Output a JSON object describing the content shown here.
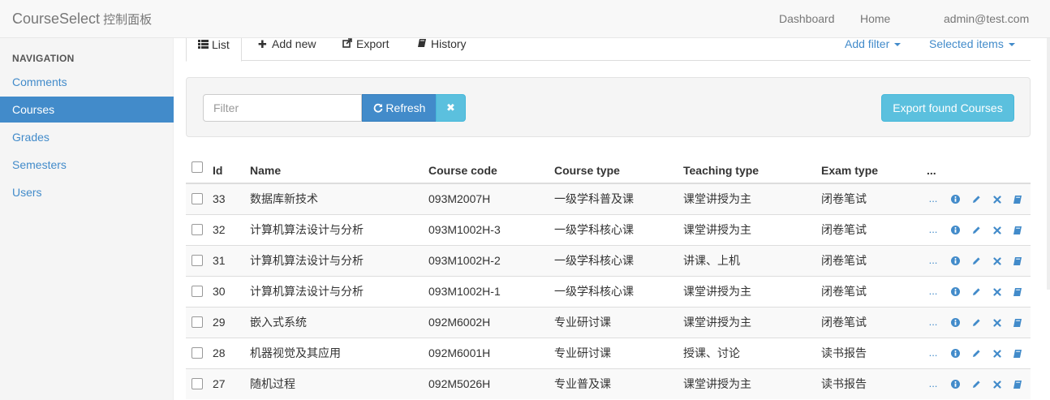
{
  "navbar": {
    "brand": "CourseSelect",
    "brand_sub": "控制面板",
    "links": [
      "Dashboard",
      "Home",
      "admin@test.com"
    ]
  },
  "sidebar": {
    "header": "NAVIGATION",
    "items": [
      {
        "label": "Comments",
        "active": false
      },
      {
        "label": "Courses",
        "active": true
      },
      {
        "label": "Grades",
        "active": false
      },
      {
        "label": "Semesters",
        "active": false
      },
      {
        "label": "Users",
        "active": false
      }
    ]
  },
  "tabs": {
    "list": "List",
    "add_new": "Add new",
    "export": "Export",
    "history": "History",
    "add_filter": "Add filter",
    "selected_items": "Selected items"
  },
  "filter": {
    "placeholder": "Filter",
    "refresh_label": "Refresh",
    "clear_label": "✖",
    "export_found_label": "Export found Courses"
  },
  "table": {
    "headers": [
      "Id",
      "Name",
      "Course code",
      "Course type",
      "Teaching type",
      "Exam type",
      "..."
    ],
    "rows": [
      {
        "id": "33",
        "name": "数据库新技术",
        "code": "093M2007H",
        "course_type": "一级学科普及课",
        "teaching_type": "课堂讲授为主",
        "exam_type": "闭卷笔试"
      },
      {
        "id": "32",
        "name": "计算机算法设计与分析",
        "code": "093M1002H-3",
        "course_type": "一级学科核心课",
        "teaching_type": "课堂讲授为主",
        "exam_type": "闭卷笔试"
      },
      {
        "id": "31",
        "name": "计算机算法设计与分析",
        "code": "093M1002H-2",
        "course_type": "一级学科核心课",
        "teaching_type": "讲课、上机",
        "exam_type": "闭卷笔试"
      },
      {
        "id": "30",
        "name": "计算机算法设计与分析",
        "code": "093M1002H-1",
        "course_type": "一级学科核心课",
        "teaching_type": "课堂讲授为主",
        "exam_type": "闭卷笔试"
      },
      {
        "id": "29",
        "name": "嵌入式系统",
        "code": "092M6002H",
        "course_type": "专业研讨课",
        "teaching_type": "课堂讲授为主",
        "exam_type": "闭卷笔试"
      },
      {
        "id": "28",
        "name": "机器视觉及其应用",
        "code": "092M6001H",
        "course_type": "专业研讨课",
        "teaching_type": "授课、讨论",
        "exam_type": "读书报告"
      },
      {
        "id": "27",
        "name": "随机过程",
        "code": "092M5026H",
        "course_type": "专业普及课",
        "teaching_type": "课堂讲授为主",
        "exam_type": "读书报告"
      }
    ],
    "row_actions": [
      "more-icon",
      "info-icon",
      "edit-icon",
      "delete-icon",
      "history-icon"
    ],
    "more_label": "..."
  },
  "colors": {
    "primary": "#428bca",
    "info": "#5bc0de"
  }
}
